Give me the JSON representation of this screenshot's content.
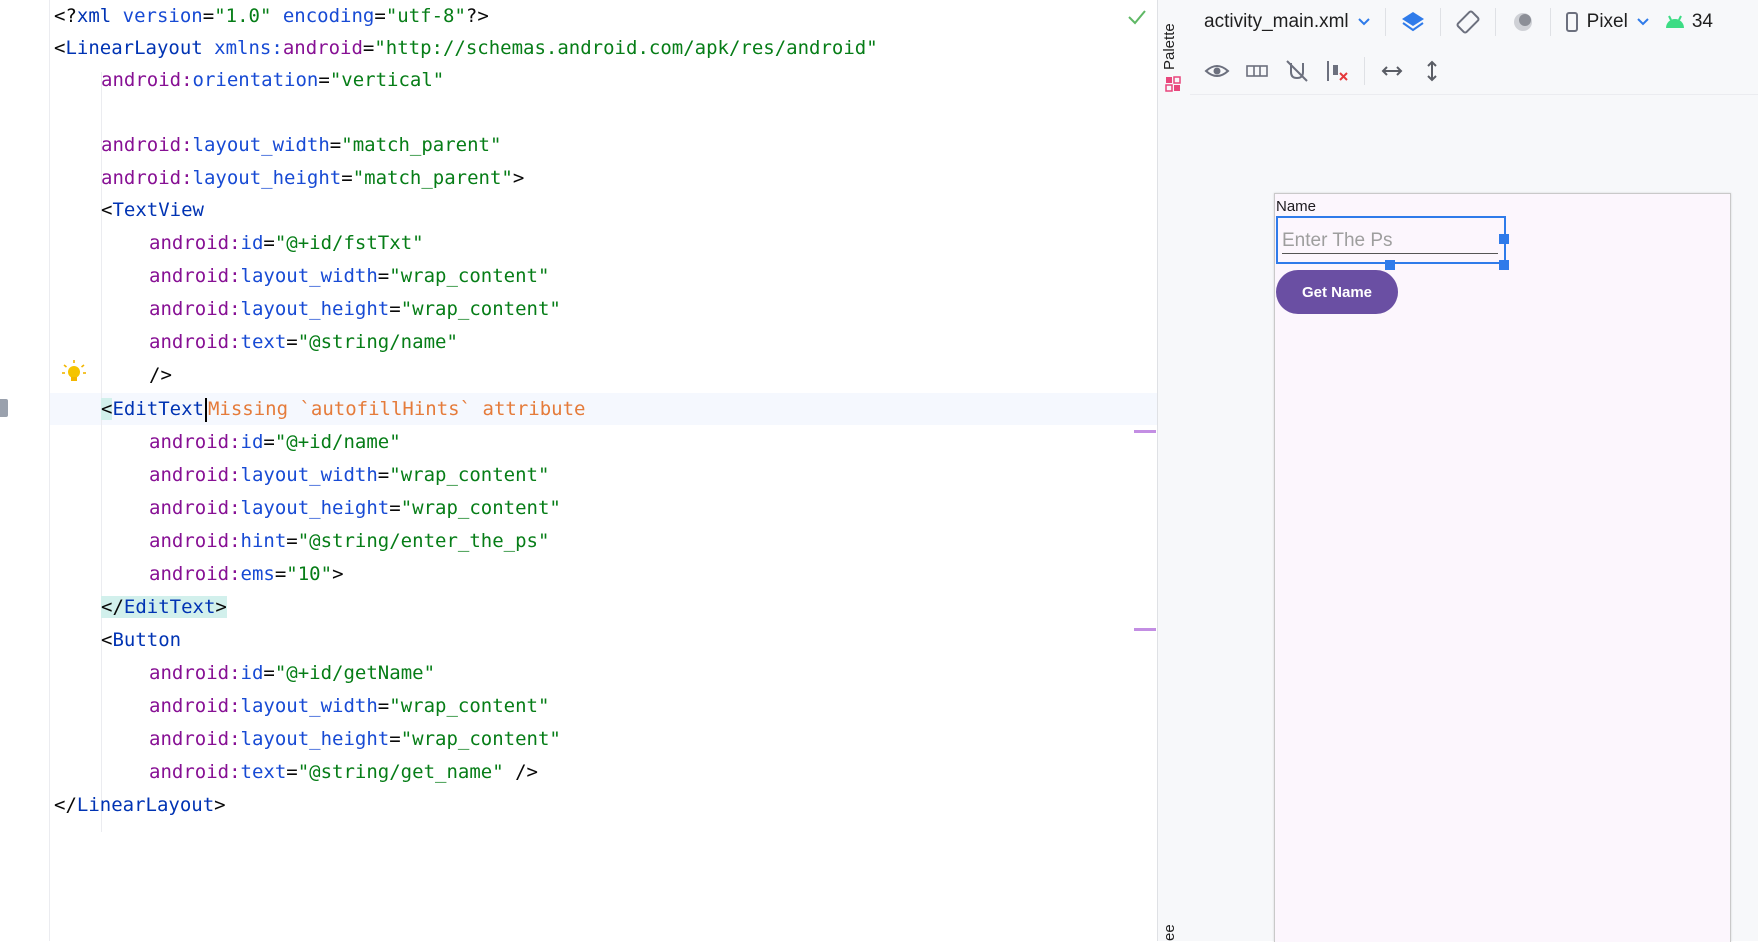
{
  "editor": {
    "lines": {
      "l1": {
        "a": "<?",
        "b": "xml ",
        "c": "version",
        "d": "=",
        "e": "\"1.0\"",
        "f": " ",
        "g": "encoding",
        "h": "=",
        "i": "\"utf-8\"",
        "j": "?>"
      },
      "l2": {
        "a": "<",
        "b": "LinearLayout",
        "c": " xmlns:",
        "d": "android",
        "e": "=",
        "f": "\"http://schemas.android.com/apk/res/android\""
      },
      "l3": {
        "ns": "android:",
        "attr": "orientation",
        "eq": "=",
        "val": "\"vertical\""
      },
      "l5": {
        "ns": "android:",
        "attr": "layout_width",
        "eq": "=",
        "val": "\"match_parent\""
      },
      "l6": {
        "ns": "android:",
        "attr": "layout_height",
        "eq": "=",
        "val": "\"match_parent\"",
        "end": ">"
      },
      "l7": {
        "lt": "<",
        "tag": "TextView"
      },
      "l8": {
        "ns": "android:",
        "attr": "id",
        "eq": "=",
        "val": "\"@+id/fstTxt\""
      },
      "l9": {
        "ns": "android:",
        "attr": "layout_width",
        "eq": "=",
        "val": "\"wrap_content\""
      },
      "l10": {
        "ns": "android:",
        "attr": "layout_height",
        "eq": "=",
        "val": "\"wrap_content\""
      },
      "l11": {
        "ns": "android:",
        "attr": "text",
        "eq": "=",
        "val": "\"@string/name\""
      },
      "l12": {
        "end": "/>"
      },
      "l13": {
        "lt": "<",
        "tag": "EditText",
        "hint": "Missing `autofillHints` attribute"
      },
      "l14": {
        "ns": "android:",
        "attr": "id",
        "eq": "=",
        "val": "\"@+id/name\""
      },
      "l15": {
        "ns": "android:",
        "attr": "layout_width",
        "eq": "=",
        "val": "\"wrap_content\""
      },
      "l16": {
        "ns": "android:",
        "attr": "layout_height",
        "eq": "=",
        "val": "\"wrap_content\""
      },
      "l17": {
        "ns": "android:",
        "attr": "hint",
        "eq": "=",
        "val": "\"@string/enter_the_ps\""
      },
      "l18": {
        "ns": "android:",
        "attr": "ems",
        "eq": "=",
        "val": "\"10\"",
        "end": ">"
      },
      "l19": {
        "lt": "</",
        "tag": "EditText",
        "gt": ">"
      },
      "l20": {
        "lt": "<",
        "tag": "Button"
      },
      "l21": {
        "ns": "android:",
        "attr": "id",
        "eq": "=",
        "val": "\"@+id/getName\""
      },
      "l22": {
        "ns": "android:",
        "attr": "layout_width",
        "eq": "=",
        "val": "\"wrap_content\""
      },
      "l23": {
        "ns": "android:",
        "attr": "layout_height",
        "eq": "=",
        "val": "\"wrap_content\""
      },
      "l24": {
        "ns": "android:",
        "attr": "text",
        "eq": "=",
        "val": "\"@string/get_name\"",
        "end": " />"
      },
      "l25": {
        "lt": "</",
        "tag": "LinearLayout",
        "gt": ">"
      }
    }
  },
  "side_tabs": {
    "palette": "Palette",
    "component_tree": "ee"
  },
  "design_toolbar": {
    "file_name": "activity_main.xml",
    "device": "Pixel",
    "api_level": "34"
  },
  "preview": {
    "label_text": "Name",
    "input_hint": "Enter The Ps",
    "button_text": "Get Name"
  },
  "colors": {
    "tag": "#0033b3",
    "attribute_namespace": "#871094",
    "attribute": "#174ad4",
    "string": "#067d17",
    "warning": "#e57b3a",
    "selection": "#2f7bea",
    "button": "#6a4fa3"
  }
}
